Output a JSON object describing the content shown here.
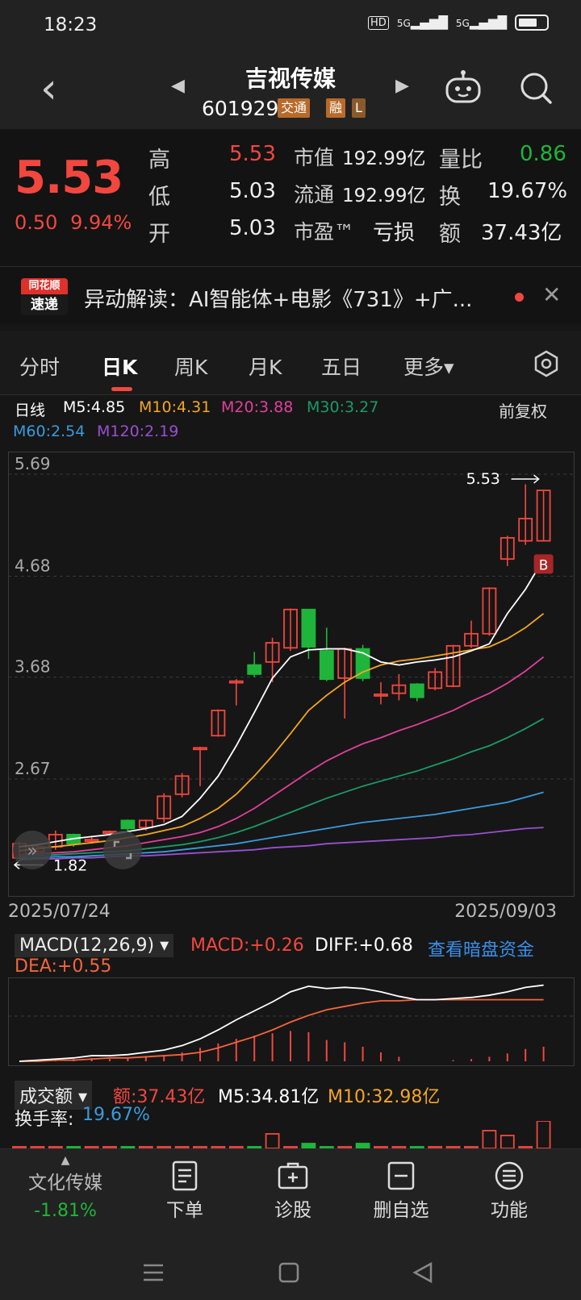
{
  "status": {
    "time": "18:23",
    "net1": "5G",
    "net2": "5G",
    "hd": "HD"
  },
  "header": {
    "name": "吉视传媒",
    "code": "601929",
    "tag1": "交通",
    "tag2": "融",
    "tag3": "L"
  },
  "quote": {
    "price": "5.53",
    "change": "0.50",
    "change_pct": "9.94%",
    "labels": {
      "high": "高",
      "low": "低",
      "open": "开",
      "mktcap": "市值",
      "float": "流通",
      "pe": "市盈™",
      "volratio": "量比",
      "turnover": "换",
      "amount": "额"
    },
    "values": {
      "high": "5.53",
      "low": "5.03",
      "open": "5.03",
      "mktcap": "192.99亿",
      "float": "192.99亿",
      "pe": "亏损",
      "volratio": "0.86",
      "turnover": "19.67%",
      "amount": "37.43亿"
    }
  },
  "news": {
    "logo_top": "同花顺",
    "logo_bottom": "速递",
    "text": "异动解读：AI智能体+电影《731》+广..."
  },
  "tabs": [
    "分时",
    "日K",
    "周K",
    "月K",
    "五日",
    "更多▾"
  ],
  "ma_legend": {
    "label": "日线",
    "m5": "M5:4.85",
    "m10": "M10:4.31",
    "m20": "M20:3.88",
    "m30": "M30:3.27",
    "m60": "M60:2.54",
    "m120": "M120:2.19",
    "adjust": "前复权"
  },
  "colors": {
    "up": "#f2473f",
    "down": "#1fb53a",
    "m5": "#ffffff",
    "m10": "#f5a623",
    "m20": "#e0409a",
    "m30": "#1a9a6a",
    "m60": "#3a9bdc",
    "m120": "#9a4fd0"
  },
  "chart_data": {
    "type": "candlestick",
    "y_ticks": [
      "5.69",
      "4.68",
      "3.68",
      "2.67"
    ],
    "ylim": [
      1.6,
      5.85
    ],
    "max_label": "5.53",
    "min_label": "1.82",
    "signal_label": "B",
    "x_start": "2025/07/24",
    "x_end": "2025/09/03",
    "candles": [
      {
        "o": 1.89,
        "c": 2.03,
        "h": 2.05,
        "l": 1.88
      },
      {
        "o": 1.95,
        "c": 2.0,
        "h": 2.02,
        "l": 1.92
      },
      {
        "o": 2.0,
        "c": 2.12,
        "h": 2.16,
        "l": 1.97
      },
      {
        "o": 2.12,
        "c": 2.03,
        "h": 2.13,
        "l": 2.0
      },
      {
        "o": 2.06,
        "c": 2.07,
        "h": 2.1,
        "l": 2.03
      },
      {
        "o": 2.15,
        "c": 2.15,
        "h": 2.16,
        "l": 2.14
      },
      {
        "o": 2.26,
        "c": 2.18,
        "h": 2.27,
        "l": 2.15
      },
      {
        "o": 2.19,
        "c": 2.26,
        "h": 2.27,
        "l": 2.16
      },
      {
        "o": 2.28,
        "c": 2.5,
        "h": 2.53,
        "l": 2.24
      },
      {
        "o": 2.52,
        "c": 2.7,
        "h": 2.73,
        "l": 2.49
      },
      {
        "o": 2.97,
        "c": 2.98,
        "h": 2.99,
        "l": 2.6
      },
      {
        "o": 3.1,
        "c": 3.35,
        "h": 3.36,
        "l": 3.09
      },
      {
        "o": 3.63,
        "c": 3.64,
        "h": 3.66,
        "l": 3.4
      },
      {
        "o": 3.8,
        "c": 3.71,
        "h": 3.93,
        "l": 3.68
      },
      {
        "o": 3.83,
        "c": 4.02,
        "h": 4.07,
        "l": 3.63
      },
      {
        "o": 3.97,
        "c": 4.35,
        "h": 4.36,
        "l": 3.94
      },
      {
        "o": 4.35,
        "c": 3.98,
        "h": 4.35,
        "l": 3.86
      },
      {
        "o": 3.94,
        "c": 3.66,
        "h": 4.17,
        "l": 3.64
      },
      {
        "o": 3.67,
        "c": 3.96,
        "h": 3.97,
        "l": 3.27
      },
      {
        "o": 3.96,
        "c": 3.67,
        "h": 4.0,
        "l": 3.64
      },
      {
        "o": 3.51,
        "c": 3.51,
        "h": 3.63,
        "l": 3.41
      },
      {
        "o": 3.52,
        "c": 3.6,
        "h": 3.71,
        "l": 3.45
      },
      {
        "o": 3.61,
        "c": 3.48,
        "h": 3.62,
        "l": 3.44
      },
      {
        "o": 3.57,
        "c": 3.73,
        "h": 3.77,
        "l": 3.55
      },
      {
        "o": 3.59,
        "c": 3.99,
        "h": 4.0,
        "l": 3.58
      },
      {
        "o": 3.99,
        "c": 4.11,
        "h": 4.24,
        "l": 3.97
      },
      {
        "o": 4.11,
        "c": 4.56,
        "h": 4.57,
        "l": 4.09
      },
      {
        "o": 4.85,
        "c": 5.06,
        "h": 5.08,
        "l": 4.78
      },
      {
        "o": 5.03,
        "c": 5.25,
        "h": 5.59,
        "l": 4.99
      },
      {
        "o": 5.03,
        "c": 5.53,
        "h": 5.53,
        "l": 5.03
      }
    ],
    "ma5": [
      2.0,
      2.02,
      2.05,
      2.08,
      2.1,
      2.12,
      2.15,
      2.18,
      2.22,
      2.3,
      2.48,
      2.7,
      3.0,
      3.33,
      3.67,
      3.88,
      3.95,
      3.96,
      3.96,
      3.92,
      3.83,
      3.8,
      3.83,
      3.85,
      3.88,
      3.94,
      4.01,
      4.31,
      4.55,
      4.85
    ],
    "ma10": [
      1.96,
      1.98,
      2.0,
      2.02,
      2.04,
      2.06,
      2.09,
      2.12,
      2.16,
      2.2,
      2.28,
      2.38,
      2.52,
      2.7,
      2.9,
      3.12,
      3.35,
      3.5,
      3.63,
      3.73,
      3.8,
      3.84,
      3.86,
      3.89,
      3.92,
      3.95,
      3.98,
      4.06,
      4.17,
      4.31
    ],
    "ma20": [
      1.92,
      1.93,
      1.94,
      1.95,
      1.97,
      1.99,
      2.01,
      2.04,
      2.07,
      2.1,
      2.14,
      2.2,
      2.28,
      2.38,
      2.5,
      2.62,
      2.74,
      2.85,
      2.94,
      3.02,
      3.08,
      3.15,
      3.21,
      3.28,
      3.35,
      3.44,
      3.52,
      3.62,
      3.74,
      3.88
    ],
    "ma30": [
      1.9,
      1.91,
      1.92,
      1.93,
      1.94,
      1.95,
      1.96,
      1.98,
      2.0,
      2.02,
      2.05,
      2.09,
      2.14,
      2.2,
      2.27,
      2.34,
      2.41,
      2.48,
      2.54,
      2.6,
      2.65,
      2.7,
      2.75,
      2.81,
      2.87,
      2.94,
      3.0,
      3.08,
      3.17,
      3.27
    ],
    "ma60": [
      1.88,
      1.89,
      1.9,
      1.9,
      1.91,
      1.92,
      1.93,
      1.94,
      1.95,
      1.97,
      1.99,
      2.01,
      2.03,
      2.06,
      2.09,
      2.12,
      2.15,
      2.18,
      2.21,
      2.24,
      2.26,
      2.28,
      2.3,
      2.32,
      2.35,
      2.38,
      2.41,
      2.44,
      2.49,
      2.54
    ],
    "ma120": [
      1.87,
      1.88,
      1.88,
      1.89,
      1.89,
      1.9,
      1.91,
      1.91,
      1.92,
      1.93,
      1.94,
      1.95,
      1.96,
      1.97,
      1.99,
      2.0,
      2.01,
      2.03,
      2.04,
      2.05,
      2.06,
      2.07,
      2.08,
      2.09,
      2.11,
      2.12,
      2.14,
      2.16,
      2.18,
      2.19
    ]
  },
  "macd": {
    "selector": "MACD(12,26,9)",
    "macd": "MACD:+0.26",
    "diff": "DIFF:+0.68",
    "dea": "DEA:+0.55",
    "link": "查看暗盘资金",
    "diff_series": [
      0.0,
      0.01,
      0.02,
      0.03,
      0.05,
      0.05,
      0.06,
      0.08,
      0.1,
      0.14,
      0.2,
      0.28,
      0.37,
      0.45,
      0.53,
      0.62,
      0.67,
      0.65,
      0.66,
      0.65,
      0.62,
      0.58,
      0.55,
      0.55,
      0.56,
      0.57,
      0.59,
      0.62,
      0.66,
      0.68
    ],
    "dea_series": [
      0.0,
      0.0,
      0.01,
      0.01,
      0.02,
      0.03,
      0.03,
      0.04,
      0.05,
      0.06,
      0.08,
      0.12,
      0.17,
      0.22,
      0.28,
      0.35,
      0.41,
      0.46,
      0.49,
      0.52,
      0.54,
      0.54,
      0.55,
      0.55,
      0.55,
      0.55,
      0.55,
      0.55,
      0.55,
      0.55
    ],
    "bars": [
      0.0,
      0.01,
      0.01,
      0.02,
      0.03,
      0.02,
      0.03,
      0.04,
      0.05,
      0.08,
      0.12,
      0.16,
      0.2,
      0.23,
      0.25,
      0.27,
      0.26,
      0.19,
      0.17,
      0.13,
      0.08,
      0.04,
      0.0,
      0.0,
      0.01,
      0.02,
      0.04,
      0.07,
      0.11,
      0.13
    ]
  },
  "volume": {
    "selector": "成交额",
    "amount": "额:37.43亿",
    "m5": "M5:34.81亿",
    "m10": "M10:32.98亿",
    "turnover_label": "换手率:",
    "turnover": "19.67%"
  },
  "bottom": {
    "sector": "文化传媒",
    "sector_chg": "-1.81%",
    "order": "下单",
    "diag": "诊股",
    "remove": "删自选",
    "func": "功能"
  }
}
